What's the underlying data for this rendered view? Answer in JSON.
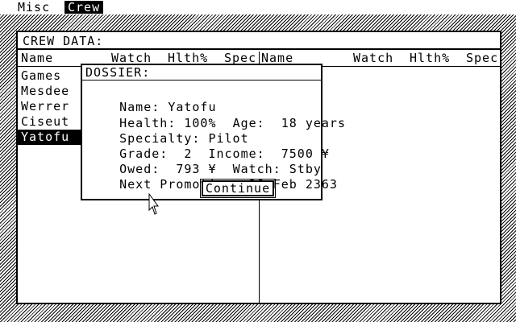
{
  "menubar": {
    "items": [
      {
        "label": "Misc",
        "active": false
      },
      {
        "label": "Crew",
        "active": true
      }
    ]
  },
  "window": {
    "title": "CREW DATA:",
    "columns_left": [
      "Name",
      "Watch",
      "Hlth%",
      "Spec"
    ],
    "columns_right": [
      "Name",
      "Watch",
      "Hlth%",
      "Spec"
    ]
  },
  "crew_list": [
    {
      "name": "Games",
      "selected": false
    },
    {
      "name": "Mesdee",
      "selected": false
    },
    {
      "name": "Werrer",
      "selected": false
    },
    {
      "name": "Ciseut",
      "selected": false
    },
    {
      "name": "Yatofu",
      "selected": true
    }
  ],
  "dossier": {
    "title": "DOSSIER:",
    "name_label": "Name:",
    "name": "Yatofu",
    "health_label": "Health:",
    "health": "100%",
    "age_label": "Age:",
    "age": "18 years",
    "specialty_label": "Specialty:",
    "specialty": "Pilot",
    "grade_label": "Grade:",
    "grade": "2",
    "income_label": "Income:",
    "income": "7500 ¥",
    "owed_label": "Owed:",
    "owed": "793 ¥",
    "watch_label": "Watch:",
    "watch": "Stby",
    "promotion_label": "Next Promotion:",
    "promotion": "28 Feb 2363",
    "continue_label": "Continue"
  }
}
